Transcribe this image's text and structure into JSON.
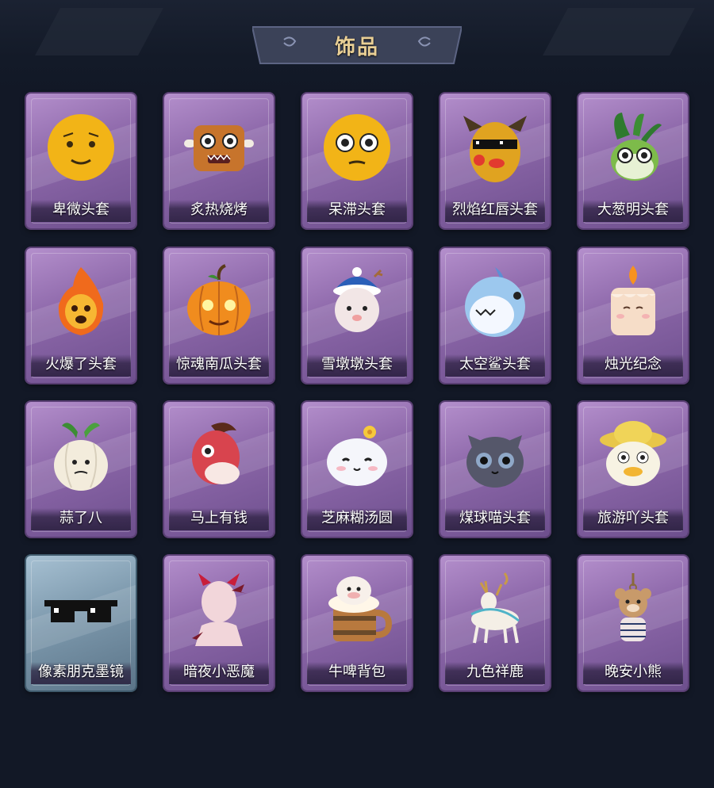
{
  "header": {
    "title": "饰品"
  },
  "items": [
    {
      "label": "卑微头套",
      "icon": "sad-yellow-face-icon",
      "color": "#f2b417",
      "frame": "purple"
    },
    {
      "label": "炙热烧烤",
      "icon": "grilled-meat-face-icon",
      "color": "#c7742c",
      "frame": "purple"
    },
    {
      "label": "呆滞头套",
      "icon": "blank-yellow-face-icon",
      "color": "#f2b417",
      "frame": "purple"
    },
    {
      "label": "烈焰红唇头套",
      "icon": "yellow-mask-sunglasses-icon",
      "color": "#e0a320",
      "frame": "purple"
    },
    {
      "label": "大葱明头套",
      "icon": "green-onion-face-icon",
      "color": "#7dbb4a",
      "frame": "purple"
    },
    {
      "label": "火爆了头套",
      "icon": "fire-spirit-icon",
      "color": "#f06a1c",
      "frame": "purple"
    },
    {
      "label": "惊魂南瓜头套",
      "icon": "pumpkin-icon",
      "color": "#f08c1e",
      "frame": "purple"
    },
    {
      "label": "雪墩墩头套",
      "icon": "snow-head-icon",
      "color": "#f2e6e6",
      "frame": "purple"
    },
    {
      "label": "太空鲨头套",
      "icon": "shark-head-icon",
      "color": "#9cc8ee",
      "frame": "purple"
    },
    {
      "label": "烛光纪念",
      "icon": "candle-icon",
      "color": "#f6ddc8",
      "frame": "purple"
    },
    {
      "label": "蒜了八",
      "icon": "garlic-icon",
      "color": "#f3ecdc",
      "frame": "purple"
    },
    {
      "label": "马上有钱",
      "icon": "red-horse-icon",
      "color": "#d8444e",
      "frame": "purple"
    },
    {
      "label": "芝麻糊汤圆",
      "icon": "rice-ball-icon",
      "color": "#f5f6fb",
      "frame": "purple"
    },
    {
      "label": "煤球喵头套",
      "icon": "black-cat-icon",
      "color": "#55576a",
      "frame": "purple"
    },
    {
      "label": "旅游吖头套",
      "icon": "duck-hat-icon",
      "color": "#f7f3e3",
      "frame": "purple"
    },
    {
      "label": "像素朋克墨镜",
      "icon": "pixel-sunglasses-icon",
      "color": "#111111",
      "frame": "blue"
    },
    {
      "label": "暗夜小恶魔",
      "icon": "devil-horns-icon",
      "color": "#f2d6da",
      "frame": "purple"
    },
    {
      "label": "牛啤背包",
      "icon": "cow-beer-mug-icon",
      "color": "#b8793e",
      "frame": "purple"
    },
    {
      "label": "九色祥鹿",
      "icon": "deer-charm-icon",
      "color": "#f4efe6",
      "frame": "purple"
    },
    {
      "label": "晚安小熊",
      "icon": "bear-charm-icon",
      "color": "#c89a6a",
      "frame": "purple"
    }
  ]
}
